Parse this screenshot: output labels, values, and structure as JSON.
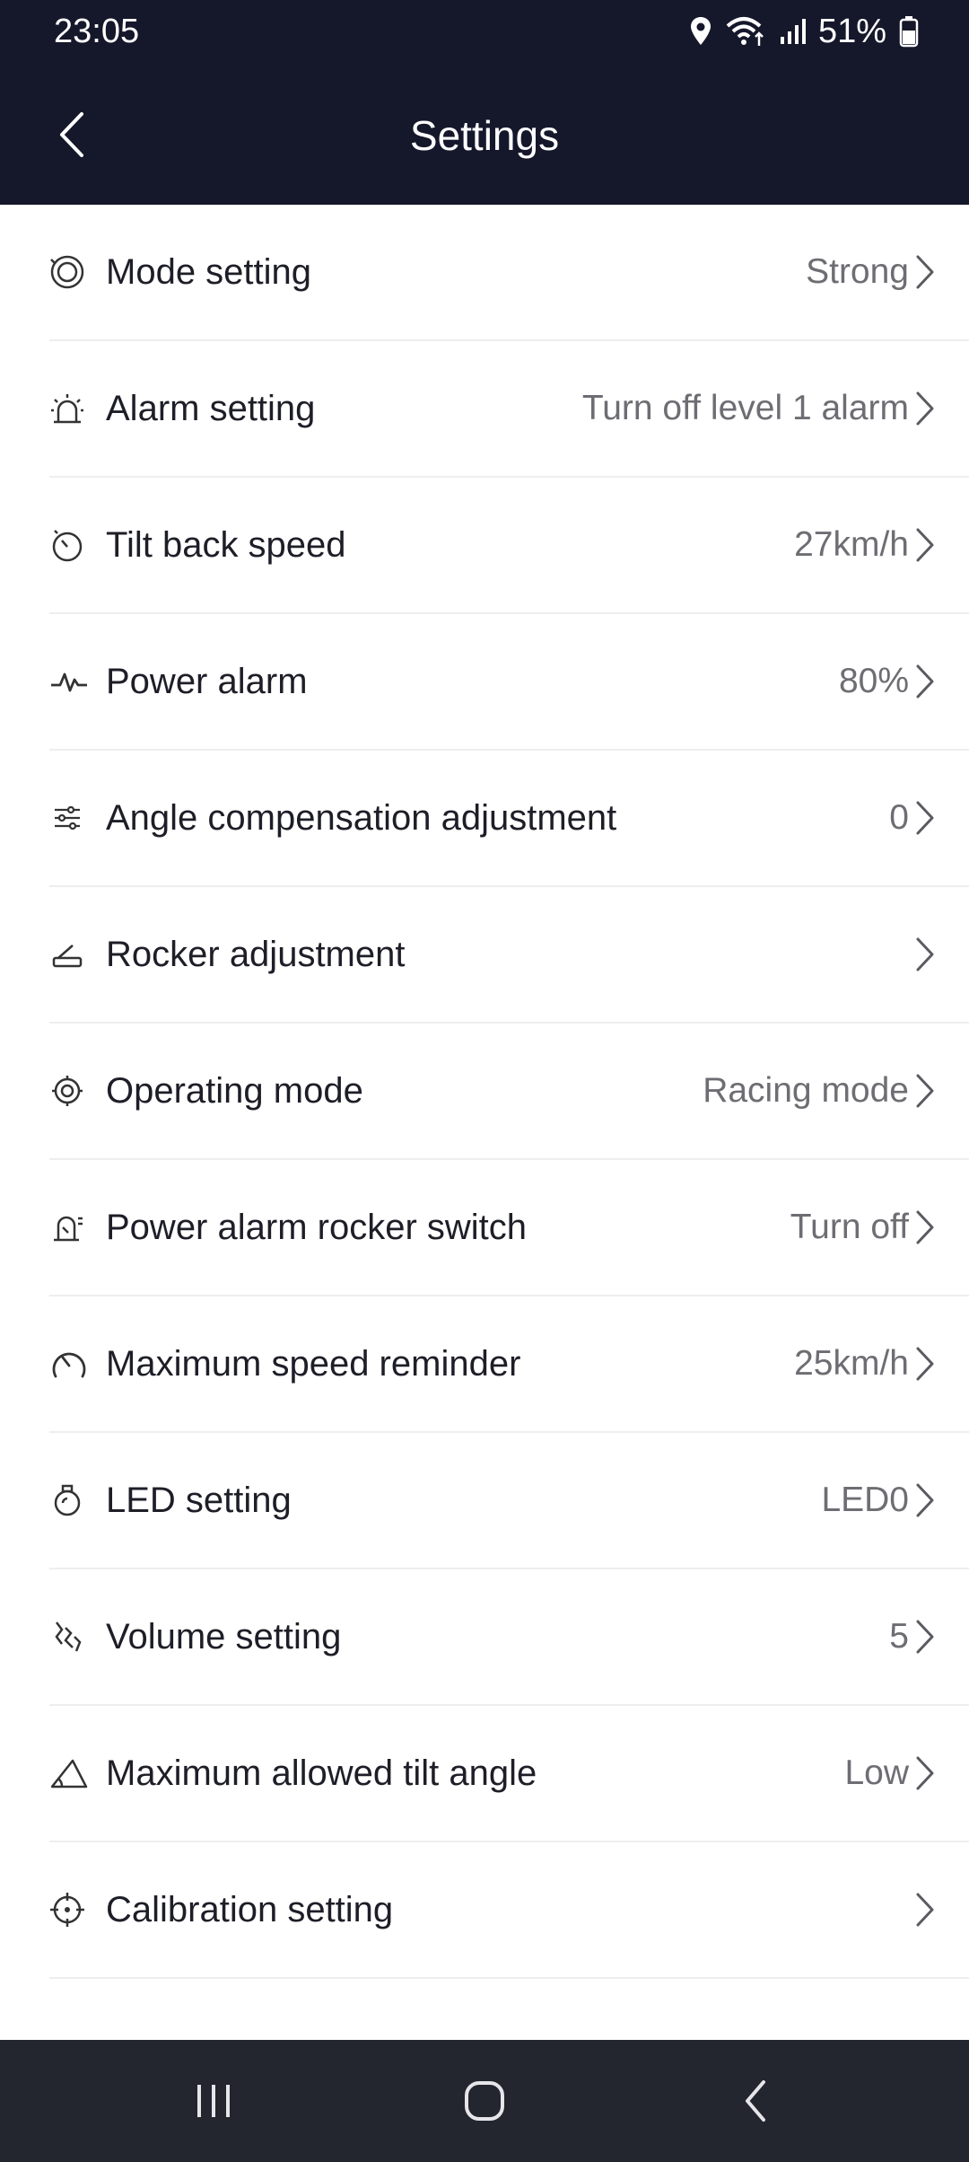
{
  "status_bar": {
    "time": "23:05",
    "battery": "51%",
    "icons": [
      "location-icon",
      "wifi-icon",
      "signal-icon",
      "battery-icon"
    ]
  },
  "header": {
    "title": "Settings",
    "back_icon": "back-chevron-icon",
    "background": "#15172b"
  },
  "settings": [
    {
      "label": "Mode setting",
      "value": "Strong",
      "icon": "mode-icon"
    },
    {
      "label": "Alarm setting",
      "value": "Turn off level 1 alarm",
      "icon": "alarm-icon"
    },
    {
      "label": "Tilt back speed",
      "value": "27km/h",
      "icon": "timer-icon"
    },
    {
      "label": "Power alarm",
      "value": "80%",
      "icon": "pulse-icon"
    },
    {
      "label": "Angle compensation adjustment",
      "value": "0",
      "icon": "sliders-icon"
    },
    {
      "label": "Rocker adjustment",
      "value": "",
      "icon": "rocker-icon"
    },
    {
      "label": "Operating mode",
      "value": "Racing mode",
      "icon": "operating-mode-icon"
    },
    {
      "label": "Power alarm rocker switch",
      "value": "Turn off",
      "icon": "alarm-switch-icon"
    },
    {
      "label": "Maximum speed reminder",
      "value": "25km/h",
      "icon": "speedometer-icon"
    },
    {
      "label": "LED setting",
      "value": "LED0",
      "icon": "bulb-icon"
    },
    {
      "label": "Volume setting",
      "value": "5",
      "icon": "volume-icon"
    },
    {
      "label": "Maximum allowed tilt angle",
      "value": "Low",
      "icon": "angle-icon"
    },
    {
      "label": "Calibration setting",
      "value": "",
      "icon": "crosshair-icon"
    }
  ],
  "nav_bar": {
    "buttons": [
      "recent-apps-icon",
      "home-icon",
      "back-icon"
    ]
  }
}
